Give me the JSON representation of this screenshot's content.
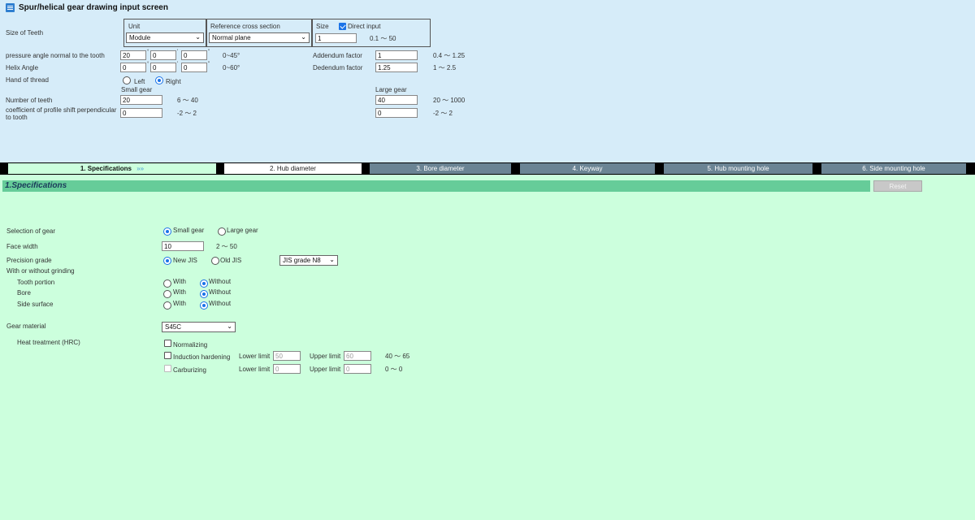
{
  "header": {
    "title": "Spur/helical gear drawing input screen"
  },
  "size_of_teeth": {
    "label": "Size of Teeth",
    "unit_label": "Unit",
    "unit_value": "Module",
    "ref_label": "Reference cross section",
    "ref_value": "Normal plane",
    "size_label": "Size",
    "direct_input_label": "Direct input",
    "direct_input_checked": true,
    "size_value": "1",
    "size_range": "0.1 ～ 50"
  },
  "pressure_angle": {
    "label": "pressure angle normal to the tooth",
    "deg": "20",
    "min": "0",
    "sec": "0",
    "range": "0~45°"
  },
  "helix_angle": {
    "label": "Helix Angle",
    "deg": "0",
    "min": "0",
    "sec": "0",
    "range": "0~60°"
  },
  "addendum": {
    "label": "Addendum factor",
    "value": "1",
    "range": "0.4 ～ 1.25"
  },
  "dedendum": {
    "label": "Dedendum factor",
    "value": "1.25",
    "range": "1 ～ 2.5"
  },
  "hand_of_thread": {
    "label": "Hand of thread",
    "left": "Left",
    "right": "Right",
    "selected": "Right"
  },
  "small_gear_label": "Small gear",
  "large_gear_label": "Large gear",
  "number_of_teeth": {
    "label": "Number of teeth",
    "small_value": "20",
    "small_range": "6 ～ 40",
    "large_value": "40",
    "large_range": "20 ～ 1000"
  },
  "profile_shift": {
    "label": "coefficient of profile shift perpendicular to tooth",
    "small_value": "0",
    "small_range": "-2 ～ 2",
    "large_value": "0",
    "large_range": "-2 ～ 2"
  },
  "tabs": [
    {
      "label": "1. Specifications",
      "suffix": "»»",
      "active": true
    },
    {
      "label": "2. Hub diameter"
    },
    {
      "label": "3. Bore diameter"
    },
    {
      "label": "4. Keyway"
    },
    {
      "label": "5. Hub mounting hole"
    },
    {
      "label": "6. Side mounting hole"
    }
  ],
  "section": {
    "title": "1.Specifications",
    "reset_label": "Reset"
  },
  "selection_of_gear": {
    "label": "Selection of gear",
    "small": "Small gear",
    "large": "Large gear",
    "selected": "Small gear"
  },
  "face_width": {
    "label": "Face width",
    "value": "10",
    "range": "2 ～ 50"
  },
  "precision_grade": {
    "label": "Precision grade",
    "new_jis": "New JIS",
    "old_jis": "Old JIS",
    "selected": "New JIS",
    "grade_value": "JIS grade N8"
  },
  "grinding": {
    "label": "With or without grinding",
    "rows": [
      {
        "label": "Tooth portion",
        "with": "With",
        "without": "Without",
        "selected": "Without"
      },
      {
        "label": "Bore",
        "with": "With",
        "without": "Without",
        "selected": "Without"
      },
      {
        "label": "Side surface",
        "with": "With",
        "without": "Without",
        "selected": "Without"
      }
    ]
  },
  "gear_material": {
    "label": "Gear material",
    "value": "S45C"
  },
  "heat_treatment": {
    "label": "Heat treatment (HRC)",
    "normalizing": "Normalizing",
    "induction": "Induction hardening",
    "carburizing": "Carburizing",
    "lower_label": "Lower limit",
    "upper_label": "Upper limit",
    "induction_lower": "50",
    "induction_upper": "60",
    "induction_range": "40 ～ 65",
    "carb_lower": "0",
    "carb_upper": "0",
    "carb_range": "0 ～ 0"
  },
  "colors": {
    "top_background": "#d6ecf9",
    "main_background": "#ccffdd",
    "section_bar": "#66cc99",
    "tab_inactive": "#6b8494",
    "accent": "#1a73e8"
  }
}
